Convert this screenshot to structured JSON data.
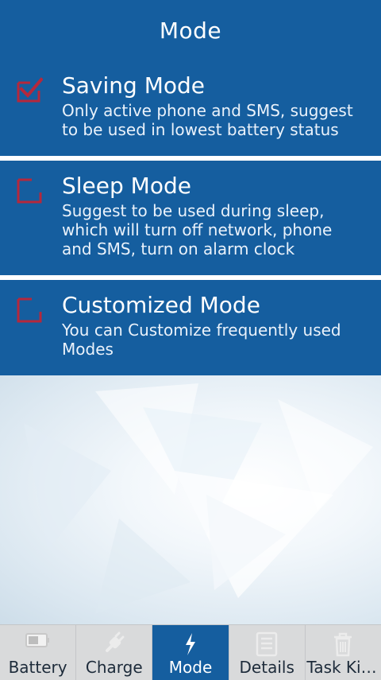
{
  "header": {
    "title": "Mode"
  },
  "modes": [
    {
      "title": "Saving Mode",
      "description": "Only active phone and SMS, suggest to be used in lowest battery status",
      "checked": true
    },
    {
      "title": "Sleep Mode",
      "description": "Suggest to be used during sleep, which will turn off network, phone and SMS, turn on alarm clock",
      "checked": false
    },
    {
      "title": "Customized Mode",
      "description": "You can Customize frequently used Modes",
      "checked": false
    }
  ],
  "tabs": [
    {
      "label": "Battery",
      "icon": "battery-icon",
      "active": false
    },
    {
      "label": "Charge",
      "icon": "plug-icon",
      "active": false
    },
    {
      "label": "Mode",
      "icon": "lightning-icon",
      "active": true
    },
    {
      "label": "Details",
      "icon": "document-icon",
      "active": false
    },
    {
      "label": "Task Kil...",
      "icon": "trash-icon",
      "active": false
    }
  ],
  "colors": {
    "primary": "#155e9f",
    "checkbox": "#b5283c",
    "nav_bg": "#d9dadb"
  }
}
